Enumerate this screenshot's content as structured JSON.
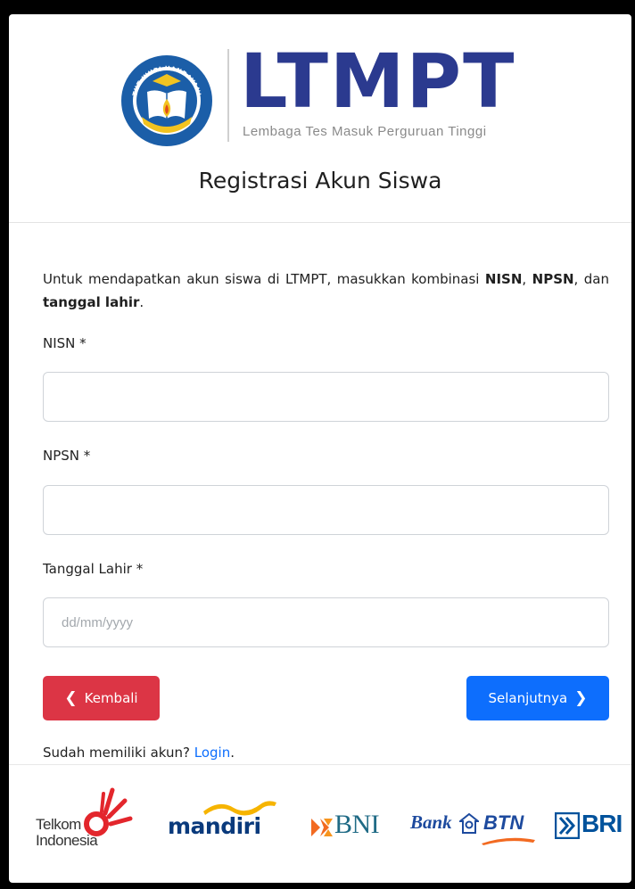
{
  "header": {
    "logo_text": "LTMPT",
    "logo_subtitle": "Lembaga Tes Masuk Perguruan Tinggi",
    "emblem_text": "TUT WURI HANDAYANI",
    "page_title": "Registrasi Akun Siswa"
  },
  "intro": {
    "prefix": "Untuk mendapatkan akun siswa di LTMPT, masukkan kombinasi ",
    "nisn": "NISN",
    "sep1": ", ",
    "npsn": "NPSN",
    "sep2": ", dan ",
    "tanggal": "tanggal lahir",
    "suffix": "."
  },
  "form": {
    "nisn_label": "NISN *",
    "nisn_value": "",
    "npsn_label": "NPSN *",
    "npsn_value": "",
    "tanggal_label": "Tanggal Lahir *",
    "tanggal_value": "",
    "tanggal_placeholder": "dd/mm/yyyy"
  },
  "buttons": {
    "back_label": "Kembali",
    "next_label": "Selanjutnya"
  },
  "login": {
    "prompt": "Sudah memiliki akun? ",
    "link_label": "Login",
    "suffix": "."
  },
  "partners": {
    "telkom_line1": "Telkom",
    "telkom_line2": "Indonesia",
    "mandiri": "mandiri",
    "bni": "BNI",
    "btn_prefix": "Bank",
    "btn": "BTN",
    "bri": "BRI"
  },
  "colors": {
    "brand_blue": "#2b3a8f",
    "danger": "#dc3545",
    "primary": "#0d6efd",
    "telkom_red": "#e3262c",
    "mandiri_yellow": "#f6b400",
    "bni_orange": "#f26a21"
  }
}
